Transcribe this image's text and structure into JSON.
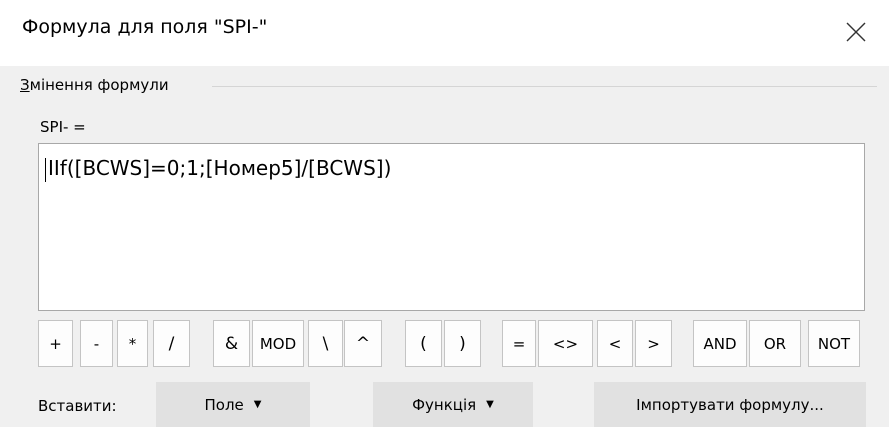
{
  "window": {
    "title": "Формула для поля \"SPI-\"",
    "close_icon": "close-icon"
  },
  "group": {
    "label": "Змінення формули",
    "mnemonic": "З"
  },
  "formula": {
    "label": "SPI- =",
    "value": "IIf([BCWS]=0;1;[Номер5]/[BCWS])"
  },
  "operators": [
    "+",
    "-",
    "*",
    "/",
    "&",
    "MOD",
    "\\",
    "^",
    "(",
    ")",
    "=",
    "<>",
    "<",
    ">",
    "AND",
    "OR",
    "NOT"
  ],
  "insert": {
    "label": "Вставити:",
    "field_button": "Поле",
    "function_button": "Функція",
    "import_button": "Імпортувати формулу...",
    "dropdown_icon": "chevron-down-icon"
  }
}
